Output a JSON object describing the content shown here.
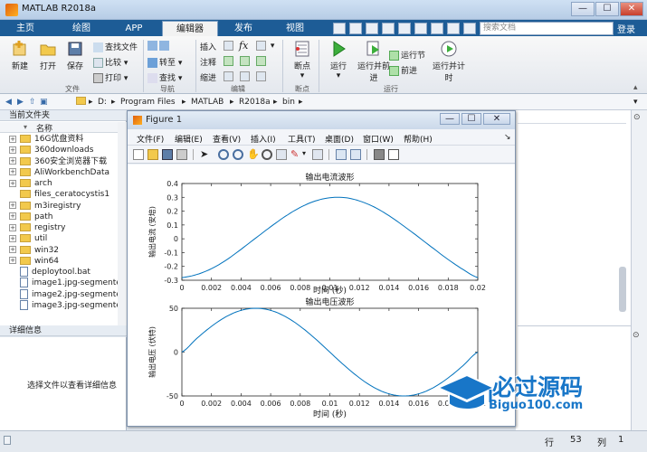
{
  "window": {
    "title": "MATLAB R2018a",
    "min": "—",
    "max": "☐",
    "close": "✕"
  },
  "ribbon_tabs": [
    "主页",
    "绘图",
    "APP",
    "编辑器",
    "发布",
    "视图"
  ],
  "search_placeholder": "搜索文档",
  "login_label": "登录",
  "ribbon": {
    "file": {
      "new": "新建",
      "open": "打开",
      "save": "保存",
      "find_files": "查找文件",
      "compare": "比较",
      "print": "打印",
      "group": "文件"
    },
    "nav": {
      "goto": "转至",
      "find": "查找",
      "group": "导航"
    },
    "edit": {
      "insert": "插入",
      "comment": "注释",
      "indent": "缩进",
      "fx": "fx",
      "group": "编辑"
    },
    "breakpoints": {
      "label": "断点",
      "group": "断点"
    },
    "run": {
      "run": "运行",
      "run_advance": "运行并前进",
      "run_section": "运行节",
      "advance": "前进",
      "run_time": "运行并计时",
      "group": "运行"
    }
  },
  "address": {
    "path": [
      "D:",
      "Program Files",
      "MATLAB",
      "R2018a",
      "bin"
    ]
  },
  "current_folder": {
    "title": "当前文件夹",
    "col_name": "名称",
    "items": [
      {
        "name": "16G优盘资料",
        "type": "folder",
        "expandable": true
      },
      {
        "name": "360downloads",
        "type": "folder",
        "expandable": true
      },
      {
        "name": "360安全浏览器下载",
        "type": "folder",
        "expandable": true
      },
      {
        "name": "AliWorkbenchData",
        "type": "folder",
        "expandable": true
      },
      {
        "name": "arch",
        "type": "folder",
        "expandable": true
      },
      {
        "name": "files_ceratocystis1",
        "type": "folder",
        "expandable": false
      },
      {
        "name": "m3iregistry",
        "type": "folder",
        "expandable": true
      },
      {
        "name": "path",
        "type": "folder",
        "expandable": true
      },
      {
        "name": "registry",
        "type": "folder",
        "expandable": true
      },
      {
        "name": "util",
        "type": "folder",
        "expandable": true
      },
      {
        "name": "win32",
        "type": "folder",
        "expandable": true
      },
      {
        "name": "win64",
        "type": "folder",
        "expandable": true
      },
      {
        "name": "deploytool.bat",
        "type": "file",
        "expandable": false
      },
      {
        "name": "image1.jpg-segmente...",
        "type": "file",
        "expandable": false
      },
      {
        "name": "image2.jpg-segmente...",
        "type": "file",
        "expandable": false
      },
      {
        "name": "image3.jpg-segmente...",
        "type": "file",
        "expandable": false
      }
    ]
  },
  "details": {
    "title": "详细信息",
    "hint": "选择文件以查看详细信息"
  },
  "status": {
    "row_label": "行",
    "row": "53",
    "col_label": "列",
    "col": "1"
  },
  "figure": {
    "title": "Figure 1",
    "menu": [
      "文件(F)",
      "编辑(E)",
      "查看(V)",
      "插入(I)",
      "工具(T)",
      "桌面(D)",
      "窗口(W)",
      "帮助(H)"
    ]
  },
  "chart_data": [
    {
      "type": "line",
      "title": "输出电流波形",
      "xlabel": "",
      "ylabel": "输出电流 (安培)",
      "xlim": [
        0,
        0.02
      ],
      "ylim": [
        -0.3,
        0.4
      ],
      "xticks": [
        "0",
        "0.002",
        "0.004",
        "0.006",
        "0.008",
        "0.01",
        "0.012",
        "0.014",
        "0.016",
        "0.018",
        "0.02"
      ],
      "yticks": [
        "0.4",
        "0.3",
        "0.2",
        "0.1",
        "0",
        "-0.1",
        "-0.2",
        "-0.3"
      ],
      "series": [
        {
          "color": "#0072bd",
          "x": [
            0,
            0.001,
            0.002,
            0.003,
            0.004,
            0.005,
            0.006,
            0.007,
            0.008,
            0.009,
            0.01,
            0.011,
            0.012,
            0.013,
            0.014,
            0.015,
            0.016,
            0.017,
            0.018,
            0.019,
            0.02
          ],
          "y": [
            -0.281,
            -0.259,
            -0.216,
            -0.154,
            -0.076,
            0.006,
            0.087,
            0.163,
            0.227,
            0.273,
            0.297,
            0.298,
            0.274,
            0.23,
            0.167,
            0.092,
            0.012,
            -0.07,
            -0.15,
            -0.222,
            -0.281
          ]
        }
      ]
    },
    {
      "type": "line",
      "title": "输出电压波形",
      "xlabel": "时间 (秒)",
      "ylabel": "输出电压 (伏特)",
      "xlim": [
        0,
        0.02
      ],
      "ylim": [
        -50,
        50
      ],
      "xticks": [
        "0",
        "0.002",
        "0.004",
        "0.006",
        "0.008",
        "0.01",
        "0.012",
        "0.014",
        "0.016",
        "0.018",
        "0.02"
      ],
      "yticks": [
        "50",
        "0",
        "-50"
      ],
      "series": [
        {
          "color": "#0072bd",
          "x": [
            0,
            0.001,
            0.002,
            0.003,
            0.004,
            0.005,
            0.006,
            0.007,
            0.008,
            0.009,
            0.01,
            0.011,
            0.012,
            0.013,
            0.014,
            0.015,
            0.016,
            0.017,
            0.018,
            0.019,
            0.02
          ],
          "y": [
            0,
            15.5,
            29.4,
            40.5,
            47.6,
            50,
            47.6,
            40.5,
            29.4,
            15.5,
            0,
            -15.5,
            -29.4,
            -40.5,
            -47.6,
            -50,
            -47.6,
            -40.5,
            -29.4,
            -15.5,
            0
          ]
        }
      ]
    }
  ],
  "chart_xlabel_top": "时间 (秒)",
  "watermark": {
    "main": "必过源码",
    "sub": "Biguo100.com"
  },
  "colors": {
    "tab_bar": "#1d5c96",
    "line": "#0072bd",
    "folder": "#f2c94c"
  }
}
